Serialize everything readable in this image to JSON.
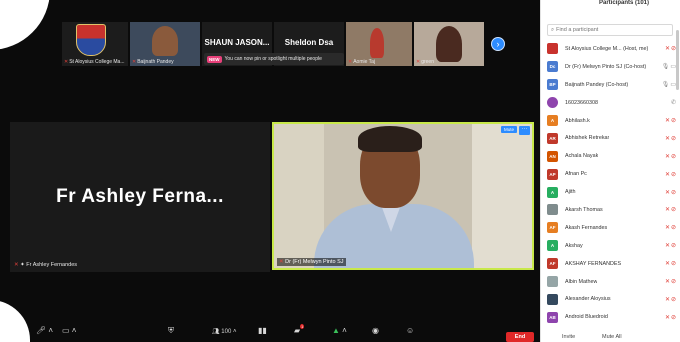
{
  "strip": {
    "tiles": [
      {
        "name": "St Aloysius College Ma..."
      },
      {
        "name": "Baijnath Pandey"
      },
      {
        "name": "SHAUN JASON..."
      },
      {
        "name": "Sheldon Dsa"
      },
      {
        "name": "Aomie Taj"
      },
      {
        "name": "green"
      }
    ],
    "toast": {
      "badge": "NEW",
      "text": "You can now pin or spotlight multiple people"
    },
    "next_icon": "chevron-right-icon"
  },
  "speakers": {
    "left": {
      "big_name": "Fr Ashley Ferna...",
      "label": "Fr Ashley Fernandes"
    },
    "right": {
      "label": "Dr (Fr) Melwyn Pinto SJ",
      "mute": "Mute",
      "more": "···"
    }
  },
  "toolbar": {
    "participants_count": "100",
    "end": "End",
    "chat_badge": "1"
  },
  "panel": {
    "title": "Participants (101)",
    "search_placeholder": "Find a participant",
    "participants": [
      {
        "initials": "",
        "color": "#c8322d",
        "name": "St Aloysius College M...  (Host, me)",
        "icons": "mic-cam"
      },
      {
        "initials": "Dc",
        "color": "#4a7bd0",
        "name": "Dr (Fr) Melwyn Pinto SJ (Co-host)",
        "icons": "gray"
      },
      {
        "initials": "BP",
        "color": "#4a7bd0",
        "name": "Baijnath Pandey (Co-host)",
        "icons": "gray"
      },
      {
        "initials": "",
        "color": "#8e44ad",
        "name": "16023660308",
        "icons": "phone"
      },
      {
        "initials": "A",
        "color": "#e67e22",
        "name": "Abhilash.k",
        "icons": "mic-cam"
      },
      {
        "initials": "AR",
        "color": "#c0392b",
        "name": "Abhishek Retrekar",
        "icons": "mic-cam"
      },
      {
        "initials": "AN",
        "color": "#d35400",
        "name": "Achala Nayak",
        "icons": "mic-cam"
      },
      {
        "initials": "AP",
        "color": "#c0392b",
        "name": "Afnan Pc",
        "icons": "mic-cam"
      },
      {
        "initials": "A",
        "color": "#27ae60",
        "name": "Ajith",
        "icons": "mic-cam"
      },
      {
        "initials": "",
        "color": "#7f8c8d",
        "name": "Akarsh Thomas",
        "icons": "mic-cam"
      },
      {
        "initials": "AF",
        "color": "#e67e22",
        "name": "Akash Fernandes",
        "icons": "mic-cam"
      },
      {
        "initials": "A",
        "color": "#27ae60",
        "name": "Akshay",
        "icons": "mic-cam"
      },
      {
        "initials": "AF",
        "color": "#c0392b",
        "name": "AKSHAY FERNANDES",
        "icons": "mic-cam"
      },
      {
        "initials": "",
        "color": "#95a5a6",
        "name": "Albin Mathew",
        "icons": "mic-cam"
      },
      {
        "initials": "",
        "color": "#34495e",
        "name": "Alexander Aloysius",
        "icons": "mic-cam"
      },
      {
        "initials": "AB",
        "color": "#8e44ad",
        "name": "Android Bluedroid",
        "icons": "mic-cam"
      }
    ],
    "invite": "Invite",
    "mute_all": "Mute All"
  }
}
